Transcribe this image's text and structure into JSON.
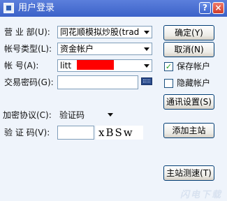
{
  "window": {
    "title": "用户登录",
    "help_label": "?",
    "close_label": "×"
  },
  "form": {
    "broker_label": "营 业 部(U):",
    "broker_value": "同花顺模拟炒股(trad",
    "account_type_label": "帐号类型(L):",
    "account_type_value": "资金帐户",
    "account_label": "帐      号(A):",
    "account_value": "litt",
    "password_label": "交易密码(G):",
    "password_value": "",
    "encrypt_label": "加密协议(C):",
    "encrypt_value": "验证码",
    "captcha_label": "验 证 码(V):",
    "captcha_value": "",
    "captcha_image_text": "xBSw"
  },
  "buttons": {
    "confirm": "确定(Y)",
    "cancel": "取消(N)",
    "comm_settings": "通讯设置(S)",
    "add_server": "添加主站",
    "server_test": "主站测速(T)"
  },
  "options": {
    "save_account_label": "保存帐户",
    "save_account_checked": true,
    "hide_account_label": "隐藏帐户",
    "hide_account_checked": false
  },
  "watermark": "闪电下载"
}
